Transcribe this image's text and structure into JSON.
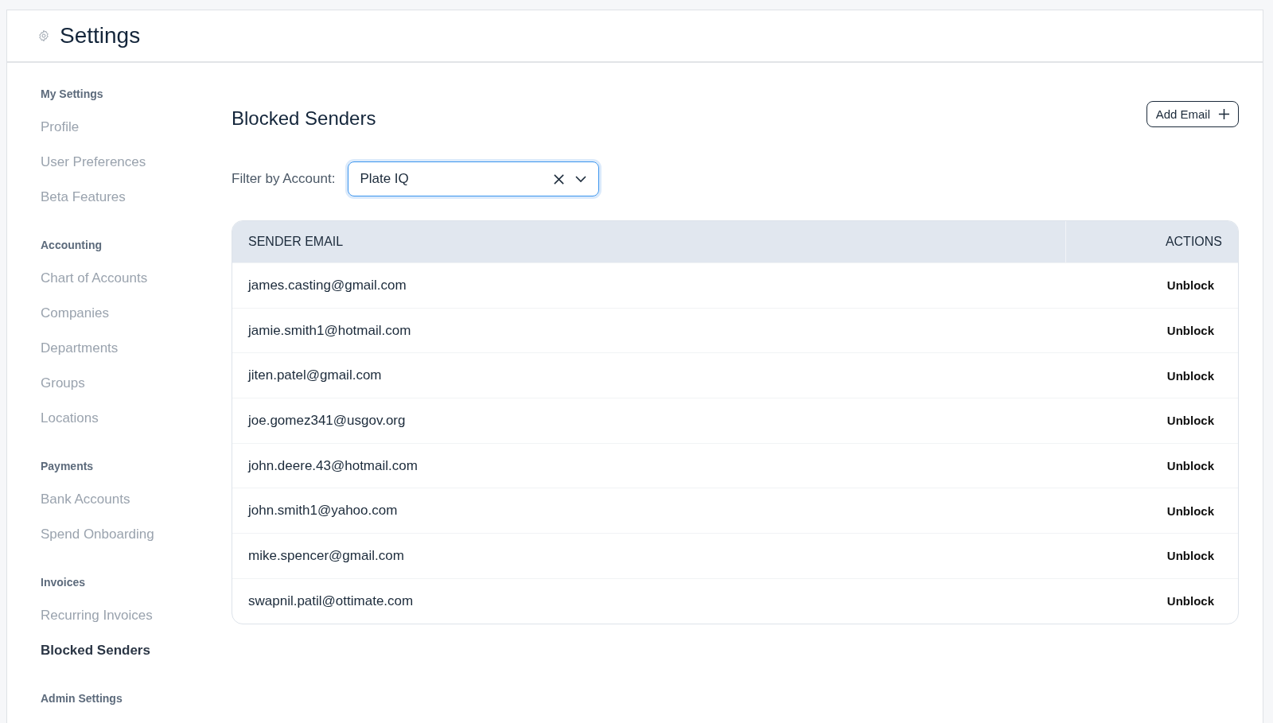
{
  "header": {
    "title": "Settings"
  },
  "sidebar": {
    "sections": [
      {
        "heading": "My Settings",
        "items": [
          {
            "label": "Profile",
            "selected": false
          },
          {
            "label": "User Preferences",
            "selected": false
          },
          {
            "label": "Beta Features",
            "selected": false
          }
        ]
      },
      {
        "heading": "Accounting",
        "items": [
          {
            "label": "Chart of Accounts",
            "selected": false
          },
          {
            "label": "Companies",
            "selected": false
          },
          {
            "label": "Departments",
            "selected": false
          },
          {
            "label": "Groups",
            "selected": false
          },
          {
            "label": "Locations",
            "selected": false
          }
        ]
      },
      {
        "heading": "Payments",
        "items": [
          {
            "label": "Bank Accounts",
            "selected": false
          },
          {
            "label": "Spend Onboarding",
            "selected": false
          }
        ]
      },
      {
        "heading": "Invoices",
        "items": [
          {
            "label": "Recurring Invoices",
            "selected": false
          },
          {
            "label": "Blocked Senders",
            "selected": true
          }
        ]
      },
      {
        "heading": "Admin Settings"
      }
    ]
  },
  "page": {
    "title": "Blocked Senders",
    "add_button": "Add Email",
    "filter_label": "Filter by Account:",
    "filter_value": "Plate IQ"
  },
  "table": {
    "columns": [
      "SENDER EMAIL",
      "ACTIONS"
    ],
    "rows": [
      {
        "email": "james.casting@gmail.com",
        "action": "Unblock"
      },
      {
        "email": "jamie.smith1@hotmail.com",
        "action": "Unblock"
      },
      {
        "email": "jiten.patel@gmail.com",
        "action": "Unblock"
      },
      {
        "email": "joe.gomez341@usgov.org",
        "action": "Unblock"
      },
      {
        "email": "john.deere.43@hotmail.com",
        "action": "Unblock"
      },
      {
        "email": "john.smith1@yahoo.com",
        "action": "Unblock"
      },
      {
        "email": "mike.spencer@gmail.com",
        "action": "Unblock"
      },
      {
        "email": "swapnil.patil@ottimate.com",
        "action": "Unblock"
      }
    ]
  }
}
